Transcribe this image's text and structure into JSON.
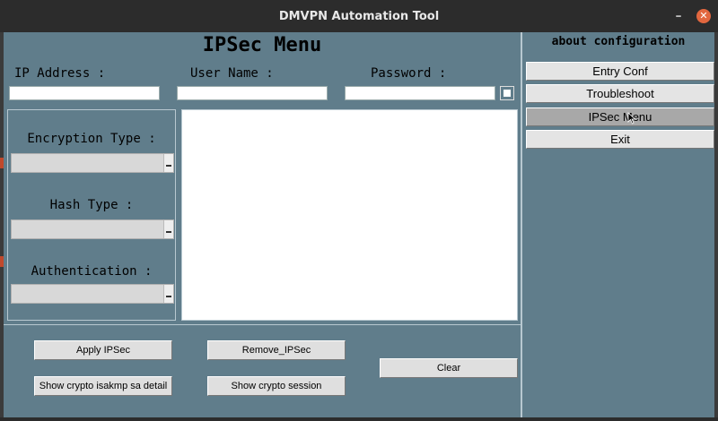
{
  "window": {
    "title": "DMVPN Automation Tool"
  },
  "main": {
    "title": "IPSec Menu",
    "fields": {
      "ip_label": "IP Address :",
      "user_label": "User Name :",
      "password_label": "Password :",
      "ip_value": "",
      "user_value": "",
      "password_value": ""
    },
    "options": {
      "encryption_label": "Encryption Type :",
      "hash_label": "Hash Type :",
      "auth_label": "Authentication :",
      "encryption_value": "",
      "hash_value": "",
      "auth_value": ""
    },
    "output_text": "",
    "buttons": {
      "apply": "Apply IPSec",
      "remove": "Remove_IPSec",
      "clear": "Clear",
      "isakmp": "Show crypto isakmp sa detail",
      "session": "Show crypto session"
    }
  },
  "sidebar": {
    "heading": "about configuration",
    "items": [
      {
        "label": "Entry Conf"
      },
      {
        "label": "Troubleshoot"
      },
      {
        "label": "IPSec Menu",
        "active": true
      },
      {
        "label": "Exit"
      }
    ]
  },
  "colors": {
    "window_bg": "#607d8b",
    "titlebar_bg": "#2c2c2c",
    "close_button": "#e2673f",
    "button_bg": "#dfdfdf",
    "active_menu_bg": "#a8a8a8"
  }
}
